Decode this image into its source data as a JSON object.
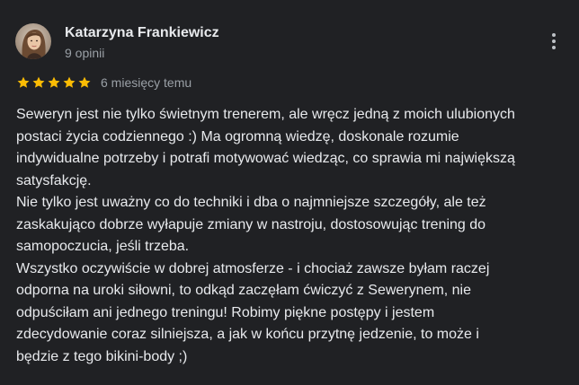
{
  "review": {
    "author": {
      "name": "Katarzyna Frankiewicz",
      "review_count": "9 opinii",
      "avatar_icon": "avatar-photo-icon"
    },
    "rating": {
      "stars": 5,
      "max_stars": 5,
      "star_color": "#fbbc04",
      "date": "6 miesięcy temu"
    },
    "more_icon": "more-vert-icon",
    "text_lines": [
      "Seweryn jest nie tylko świetnym trenerem, ale wręcz jedną z moich ulubionych",
      "postaci życia codziennego :) Ma ogromną wiedzę, doskonale rozumie",
      "indywidualne potrzeby i potrafi motywować wiedząc, co sprawia mi największą",
      "satysfakcję.",
      "Nie tylko jest uważny co do techniki i dba o najmniejsze szczegóły, ale też",
      "zaskakująco dobrze wyłapuje zmiany w nastroju, dostosowując trening do",
      "samopoczucia, jeśli trzeba.",
      "Wszystko oczywiście w dobrej atmosferze - i chociaż zawsze byłam raczej",
      "odporna na uroki siłowni, to odkąd zaczęłam ćwiczyć z Sewerynem, nie",
      "odpuściłam ani jednego treningu! Robimy piękne postępy i jestem",
      "zdecydowanie coraz silniejsza, a jak w końcu przytnę jedzenie, to może i",
      "będzie z tego bikini-body ;)"
    ]
  },
  "theme": {
    "background": "#202124",
    "text_primary": "#e8eaed",
    "text_secondary": "#9aa0a6"
  }
}
